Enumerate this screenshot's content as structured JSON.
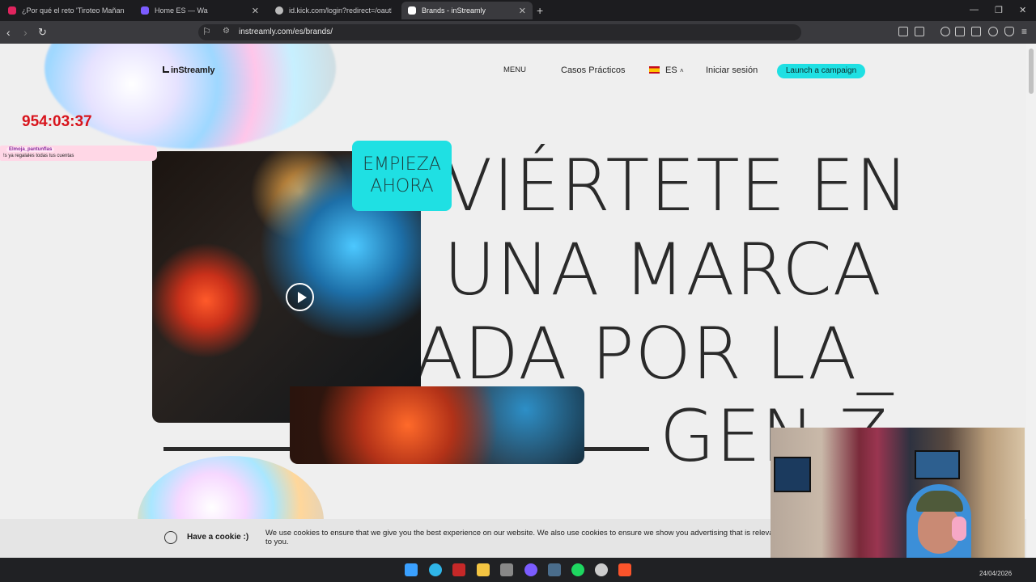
{
  "browser": {
    "tabs": [
      {
        "title": "¿Por qué el reto 'Tiroteo Mañana' tie",
        "active": false,
        "favicon_color": "#e0245e"
      },
      {
        "title": "Home ES — Wa",
        "active": false,
        "favicon_color": "#7b5cff"
      },
      {
        "title": "id.kick.com/login?redirect=/oauth/a",
        "active": false,
        "favicon_color": "#bbbbbb"
      },
      {
        "title": "Brands - inStreamly",
        "active": true,
        "favicon_color": "#ffffff"
      }
    ],
    "url": "instreamly.com/es/brands/"
  },
  "site": {
    "logo": "inStreamly",
    "nav": {
      "menu": "MENU",
      "cases": "Casos Prácticos",
      "lang": "ES",
      "login": "Iniciar sesión",
      "cta": "Launch a campaign"
    },
    "hero": {
      "line1": "VIÉRTETE EN",
      "line2": "UNA MARCA",
      "line3": "ADA POR LA_",
      "line4": "GEN Z",
      "cta_line1": "EMPIEZA",
      "cta_line2": "AHORA"
    },
    "cookie": {
      "title": "Have a cookie :)",
      "text": "We use cookies to ensure that we give you the best experience on our website. We also use cookies to ensure we show you advertising that is relevant to you."
    },
    "accent_color": "#1fe0e3"
  },
  "stream_overlay": {
    "timer": "954:03:37",
    "chat_user": "Elmoja_pantunflas",
    "chat_message": "!s ya regalales todas tus cuentas"
  },
  "taskbar": {
    "date": "24/04/2026"
  }
}
